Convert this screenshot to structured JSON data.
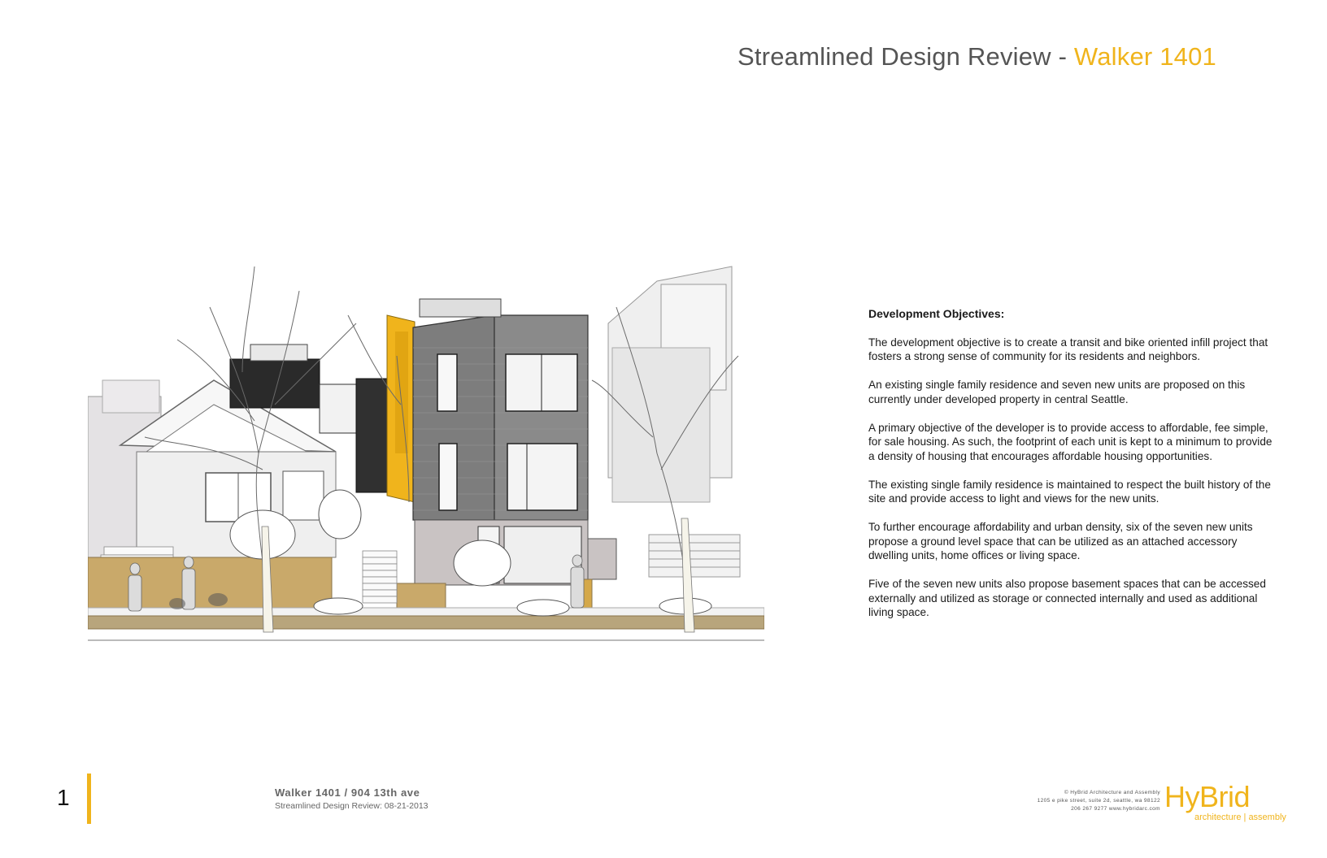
{
  "header": {
    "title_main": "Streamlined Design Review - ",
    "title_accent": "Walker 1401"
  },
  "objectives": {
    "heading": "Development Objectives:",
    "paragraphs": [
      "The development objective is to create a transit and bike oriented infill project that fosters a strong sense of community for its residents and neighbors.",
      "An existing single family residence and seven new units are proposed on this currently under developed property in central Seattle.",
      "A primary objective of the developer is to provide access to affordable, fee simple, for sale housing.  As such, the footprint of each unit is kept to a minimum to provide a density of housing that encourages affordable housing opportunities.",
      "The existing single family residence is maintained to respect the built history of the site and provide access to light and views for the new units.",
      "To further encourage affordability and urban density, six of the seven new units propose a ground level space that can be utilized as an attached accessory dwelling units, home offices or living space.",
      "Five of the seven new units also propose basement spaces that can be accessed externally and utilized as storage or connected internally and used as additional living space."
    ]
  },
  "footer": {
    "page_number": "1",
    "project": "Walker 1401 / 904 13th ave",
    "subtitle": "Streamlined Design Review: 08-21-2013",
    "credit_line1": "© HyBrid Architecture and Assembly",
    "credit_line2": "1205 e pike street, suite 2d, seattle, wa 98122",
    "credit_line3": "206 267 9277  www.hybridarc.com",
    "logo_name": "HyBrid",
    "logo_tag": "architecture | assembly"
  },
  "colors": {
    "accent": "#f0b41c",
    "title_gray": "#555555",
    "cladding": "#7a7a7a",
    "ground": "#c9a96a"
  },
  "rendering": {
    "alt": "Street elevation rendering of the existing house and new townhouse units with trees and figures"
  }
}
